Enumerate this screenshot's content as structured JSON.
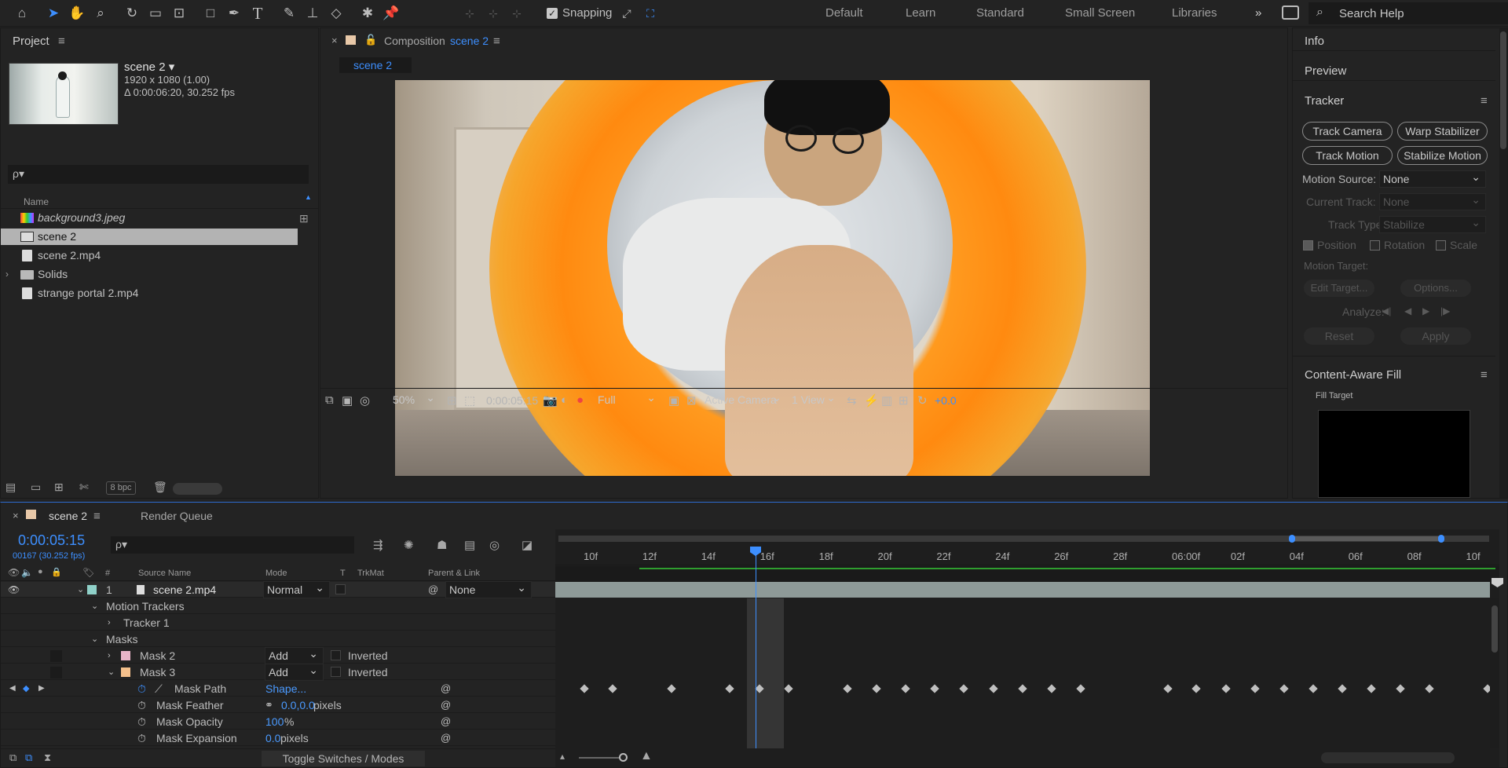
{
  "toolbar": {
    "snapping_label": "Snapping",
    "workspaces": [
      "Default",
      "Learn",
      "Standard",
      "Small Screen",
      "Libraries"
    ],
    "overflow": "»",
    "search_placeholder": "Search Help"
  },
  "project": {
    "title": "Project",
    "comp_name": "scene 2 ▾",
    "comp_size": "1920 x 1080 (1.00)",
    "comp_duration": "Δ 0:00:06:20, 30.252 fps",
    "search_placeholder": "ρ▾",
    "column_name": "Name",
    "items": [
      {
        "name": "background3.jpeg",
        "type": "image"
      },
      {
        "name": "scene 2",
        "type": "comp"
      },
      {
        "name": "scene 2.mp4",
        "type": "footage"
      },
      {
        "name": "Solids",
        "type": "folder"
      },
      {
        "name": "strange portal 2.mp4",
        "type": "footage"
      }
    ],
    "bpc": "8 bpc"
  },
  "composition": {
    "title_prefix": "Composition",
    "title_name": "scene 2",
    "tab": "scene 2",
    "zoom": "50%",
    "timecode": "0:00:05:15",
    "resolution": "Full",
    "camera": "Active Camera",
    "views": "1 View",
    "exposure": "+0.0"
  },
  "right_panels": {
    "info": "Info",
    "preview": "Preview",
    "tracker": {
      "title": "Tracker",
      "track_camera": "Track Camera",
      "warp_stabilizer": "Warp Stabilizer",
      "track_motion": "Track Motion",
      "stabilize_motion": "Stabilize Motion",
      "motion_source_label": "Motion Source:",
      "motion_source_value": "None",
      "current_track_label": "Current Track:",
      "current_track_value": "None",
      "track_type_label": "Track Type:",
      "track_type_value": "Stabilize",
      "position": "Position",
      "rotation": "Rotation",
      "scale": "Scale",
      "motion_target": "Motion Target:",
      "edit_target": "Edit Target...",
      "options": "Options...",
      "analyze": "Analyze:",
      "reset": "Reset",
      "apply": "Apply"
    },
    "caf": {
      "title": "Content-Aware Fill",
      "fill_target": "Fill Target"
    }
  },
  "timeline": {
    "tab": "scene 2",
    "render_queue": "Render Queue",
    "timecode": "0:00:05:15",
    "frame_info": "00167 (30.252 fps)",
    "search_placeholder": "ρ▾",
    "headers": {
      "num": "#",
      "source": "Source Name",
      "mode": "Mode",
      "t": "T",
      "trkmat": "TrkMat",
      "parent": "Parent & Link"
    },
    "layer": {
      "num": "1",
      "name": "scene 2.mp4",
      "mode": "Normal",
      "parent": "None"
    },
    "rows": {
      "motion_trackers": "Motion Trackers",
      "tracker1": "Tracker 1",
      "masks": "Masks",
      "mask2": "Mask 2",
      "mask2_mode": "Add",
      "mask3": "Mask 3",
      "mask3_mode": "Add",
      "inverted": "Inverted",
      "mask_path": "Mask Path",
      "mask_path_val": "Shape...",
      "mask_feather": "Mask Feather",
      "mask_feather_val": "0.0,0.0",
      "mask_feather_unit": " pixels",
      "mask_opacity": "Mask Opacity",
      "mask_opacity_val": "100",
      "mask_opacity_unit": "%",
      "mask_expansion": "Mask Expansion",
      "mask_expansion_val": "0.0",
      "mask_expansion_unit": " pixels"
    },
    "toggle": "Toggle Switches / Modes",
    "ruler": [
      "10f",
      "12f",
      "14f",
      "16f",
      "18f",
      "20f",
      "22f",
      "24f",
      "26f",
      "28f",
      "06:00f",
      "02f",
      "04f",
      "06f",
      "08f",
      "10f"
    ]
  },
  "colors": {
    "accent": "#3d8fff",
    "layer_label": "#8fd0c8",
    "mask2": "#e8b4c8",
    "mask3": "#f4c08c",
    "work_green": "#2f9e2f"
  }
}
